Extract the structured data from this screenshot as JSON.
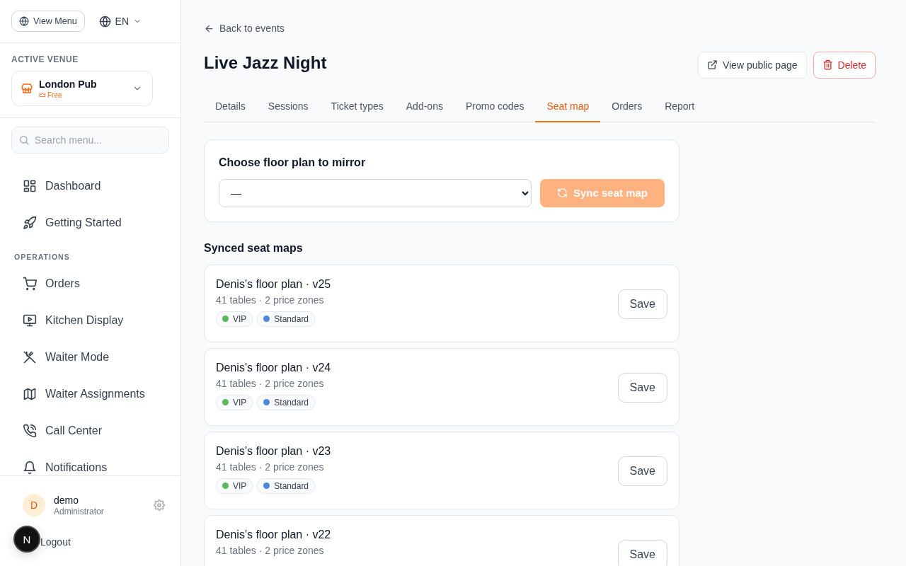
{
  "sidebar": {
    "view_menu_button": "View Menu",
    "language": "EN",
    "venue_heading": "ACTIVE VENUE",
    "venue": {
      "name": "London Pub",
      "plan": "Free"
    },
    "search": {
      "placeholder": "Search menu..."
    },
    "nav": [
      {
        "kind": "link",
        "label": "Dashboard"
      },
      {
        "kind": "link",
        "label": "Getting Started"
      },
      {
        "kind": "section",
        "label": "OPERATIONS"
      },
      {
        "kind": "link",
        "label": "Orders"
      },
      {
        "kind": "link",
        "label": "Kitchen Display"
      },
      {
        "kind": "link",
        "label": "Waiter Mode"
      },
      {
        "kind": "link",
        "label": "Waiter Assignments"
      },
      {
        "kind": "link",
        "label": "Call Center"
      },
      {
        "kind": "link",
        "label": "Notifications"
      }
    ],
    "user": {
      "initial": "D",
      "name": "demo",
      "role": "Administrator"
    },
    "logout": "Logout"
  },
  "dev_badge": "N",
  "page": {
    "back_link": "Back to events",
    "title": "Live Jazz Night",
    "actions": [
      {
        "kind": "default",
        "label": "View public page"
      },
      {
        "kind": "danger",
        "label": "Delete"
      }
    ],
    "tabs": [
      {
        "label": "Details",
        "selected": false
      },
      {
        "label": "Sessions",
        "selected": false
      },
      {
        "label": "Ticket types",
        "selected": false
      },
      {
        "label": "Add-ons",
        "selected": false
      },
      {
        "label": "Promo codes",
        "selected": false
      },
      {
        "label": "Seat map",
        "selected": true
      },
      {
        "label": "Orders",
        "selected": false
      },
      {
        "label": "Report",
        "selected": false
      }
    ],
    "mirror": {
      "heading": "Choose floor plan to mirror",
      "select_value": "—",
      "sync_button": "Sync seat map",
      "disabled": true
    },
    "synced_heading": "Synced seat maps",
    "seat_maps": [
      {
        "title": "Denis's floor plan · v25",
        "meta": "41 tables · 2 price zones",
        "zones": [
          {
            "name": "VIP",
            "color": "#5cb85c"
          },
          {
            "name": "Standard",
            "color": "#4a89dc"
          }
        ],
        "button": "Save"
      },
      {
        "title": "Denis's floor plan · v24",
        "meta": "41 tables · 2 price zones",
        "zones": [
          {
            "name": "VIP",
            "color": "#5cb85c"
          },
          {
            "name": "Standard",
            "color": "#4a89dc"
          }
        ],
        "button": "Save"
      },
      {
        "title": "Denis's floor plan · v23",
        "meta": "41 tables · 2 price zones",
        "zones": [
          {
            "name": "VIP",
            "color": "#5cb85c"
          },
          {
            "name": "Standard",
            "color": "#4a89dc"
          }
        ],
        "button": "Save"
      },
      {
        "title": "Denis's floor plan · v22",
        "meta": "41 tables · 2 price zones",
        "button": "Save"
      }
    ]
  }
}
